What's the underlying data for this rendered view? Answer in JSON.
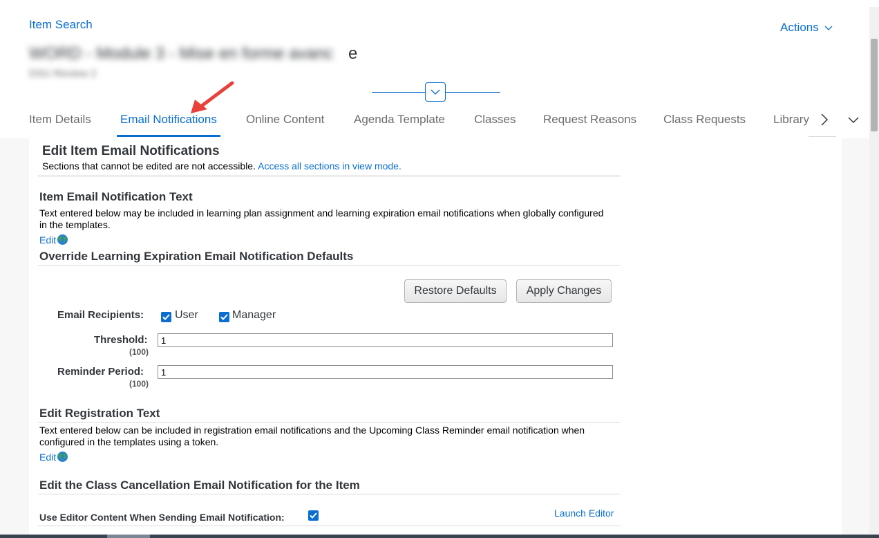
{
  "header": {
    "breadcrumb": "Item Search",
    "actions_label": "Actions",
    "title_obscured": "WORD - Module 3 - Mise en forme avanc",
    "title_tail": "e",
    "subtitle_obscured": "DSU Review 2"
  },
  "tabs": [
    {
      "label": "Item Details"
    },
    {
      "label": "Email Notifications",
      "active": true
    },
    {
      "label": "Online Content"
    },
    {
      "label": "Agenda Template"
    },
    {
      "label": "Classes"
    },
    {
      "label": "Request Reasons"
    },
    {
      "label": "Class Requests"
    },
    {
      "label": "Library"
    }
  ],
  "page": {
    "title": "Edit Item Email Notifications",
    "note_text": "Sections that cannot be edited are not accessible. ",
    "note_link": "Access all sections in view mode."
  },
  "notification_text": {
    "heading": "Item Email Notification Text",
    "description": "Text entered below may be included in learning plan assignment and learning expiration email notifications when globally configured in the templates.",
    "edit_label": "Edit"
  },
  "override": {
    "heading": "Override Learning Expiration Email Notification Defaults",
    "restore_button": "Restore Defaults",
    "apply_button": "Apply Changes",
    "recipients_label": "Email Recipients:",
    "recipient_user": "User",
    "recipient_manager": "Manager",
    "threshold_label": "Threshold:",
    "threshold_max": "(100)",
    "threshold_value": "1",
    "reminder_label": "Reminder Period:",
    "reminder_max": "(100)",
    "reminder_value": "1"
  },
  "registration": {
    "heading": "Edit Registration Text",
    "description": "Text entered below can be included in registration email notifications and the Upcoming Class Reminder email notification when configured in the templates using a token.",
    "edit_label": "Edit"
  },
  "cancellation": {
    "heading": "Edit the Class Cancellation Email Notification for the Item",
    "use_editor_label": "Use Editor Content When Sending Email Notification:",
    "launch_editor": "Launch Editor"
  },
  "colors": {
    "accent": "#0a6ed1",
    "annotation_arrow": "#e8413b"
  },
  "icons": [
    "chevron-down-icon",
    "chevron-right-icon",
    "globe-icon",
    "checkbox-checked-icon",
    "arrow-annotation-icon"
  ]
}
